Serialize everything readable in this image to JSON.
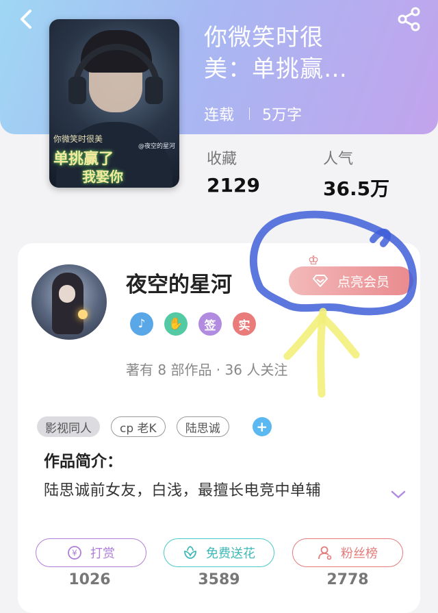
{
  "book": {
    "title": "你微笑时很美：单挑赢…",
    "status": "连载",
    "word_count": "5万字",
    "cover_text_small": "你微笑时很美",
    "cover_text_line1": "单挑赢了",
    "cover_text_line2": "我娶你",
    "cover_watermark": "@夜空的星河"
  },
  "stats": {
    "favorites_label": "收藏",
    "favorites_value": "2129",
    "popularity_label": "人气",
    "popularity_value": "36.5万"
  },
  "author": {
    "name": "夜空的星河",
    "vip_button": "点亮会员",
    "badges": [
      "music",
      "handshake",
      "签",
      "实"
    ],
    "summary": "著有 8 部作品 · 36 人关注"
  },
  "tags": [
    "影视同人",
    "cp 老K",
    "陆思诚"
  ],
  "intro": {
    "heading": "作品简介：",
    "text": "陆思诚前女友，白浅，最擅长电竞中单辅"
  },
  "actions": [
    {
      "label": "打赏",
      "count": "1026",
      "color": "#b07ed8"
    },
    {
      "label": "免费送花",
      "count": "3589",
      "color": "#4cc9c9"
    },
    {
      "label": "粉丝榜",
      "count": "2778",
      "color": "#e57b7b"
    }
  ],
  "colors": {
    "accent_blue": "#3f5fd8",
    "accent_yellow": "#f2f07a",
    "vip": "#e98a8e"
  }
}
